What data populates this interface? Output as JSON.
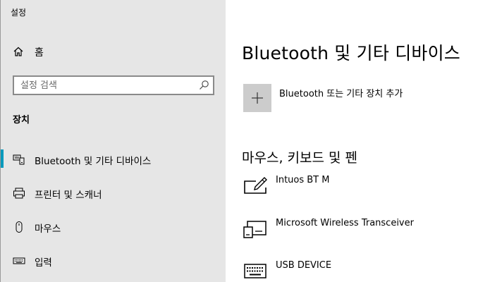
{
  "app": {
    "title": "설정"
  },
  "sidebar": {
    "home_label": "홈",
    "search": {
      "placeholder": "설정 검색"
    },
    "section_title": "장치",
    "items": [
      {
        "label": "Bluetooth 및 기타 디바이스",
        "icon": "bluetooth-devices-icon",
        "selected": true
      },
      {
        "label": "프린터 및 스캐너",
        "icon": "printer-icon",
        "selected": false
      },
      {
        "label": "마우스",
        "icon": "mouse-icon",
        "selected": false
      },
      {
        "label": "입력",
        "icon": "keyboard-icon",
        "selected": false
      }
    ]
  },
  "main": {
    "title": "Bluetooth 및 기타 디바이스",
    "add_device_label": "Bluetooth 또는 기타 장치 추가",
    "section_title": "마우스, 키보드 및 펜",
    "devices": [
      {
        "name": "Intuos BT M",
        "icon": "pen-tablet-icon"
      },
      {
        "name": "Microsoft Wireless Transceiver",
        "icon": "wireless-receiver-icon"
      },
      {
        "name": "USB DEVICE",
        "icon": "keyboard-icon"
      }
    ]
  },
  "colors": {
    "accent": "#0099bc",
    "sidebar_bg": "#e6e6e6",
    "content_bg": "#ffffff",
    "add_tile_bg": "#cccccc"
  }
}
